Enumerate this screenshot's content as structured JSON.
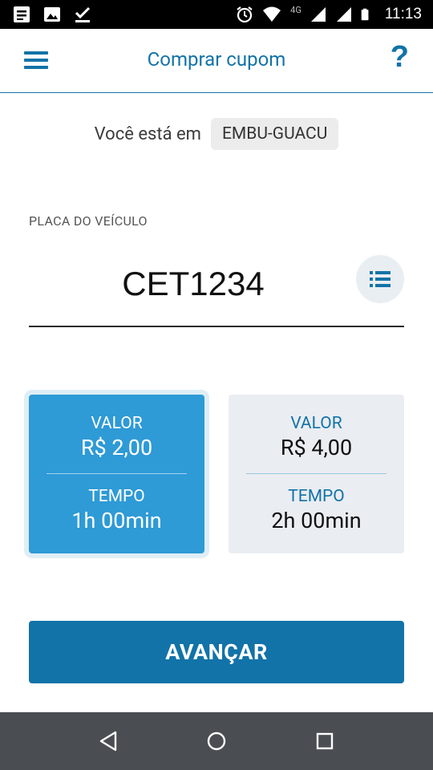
{
  "status_bar": {
    "time": "11:13",
    "network": "4G",
    "left_icons": [
      "notification-list-icon",
      "image-icon",
      "check-download-icon"
    ],
    "right_icons": [
      "alarm-icon",
      "wifi-icon",
      "signal-icon",
      "signal-icon",
      "battery-icon"
    ]
  },
  "header": {
    "title": "Comprar cupom",
    "menu_icon": "hamburger-icon",
    "help_label": "?"
  },
  "location": {
    "label": "Você está em",
    "city": "EMBU-GUACU"
  },
  "plate": {
    "label": "PLACA DO VEÍCULO",
    "value": "CET1234",
    "list_icon": "list-icon"
  },
  "options": [
    {
      "value_label": "VALOR",
      "value": "R$ 2,00",
      "time_label": "TEMPO",
      "time": "1h 00min",
      "selected": true
    },
    {
      "value_label": "VALOR",
      "value": "R$ 4,00",
      "time_label": "TEMPO",
      "time": "2h 00min",
      "selected": false
    }
  ],
  "actions": {
    "advance_label": "AVANÇAR"
  },
  "colors": {
    "primary": "#1273a8",
    "selected_card": "#2e9ad6",
    "card_bg": "#eaedf1",
    "nav_bar": "#4a4e52"
  },
  "nav_bar": {
    "icons": [
      "back-icon",
      "home-icon",
      "recents-icon"
    ]
  }
}
